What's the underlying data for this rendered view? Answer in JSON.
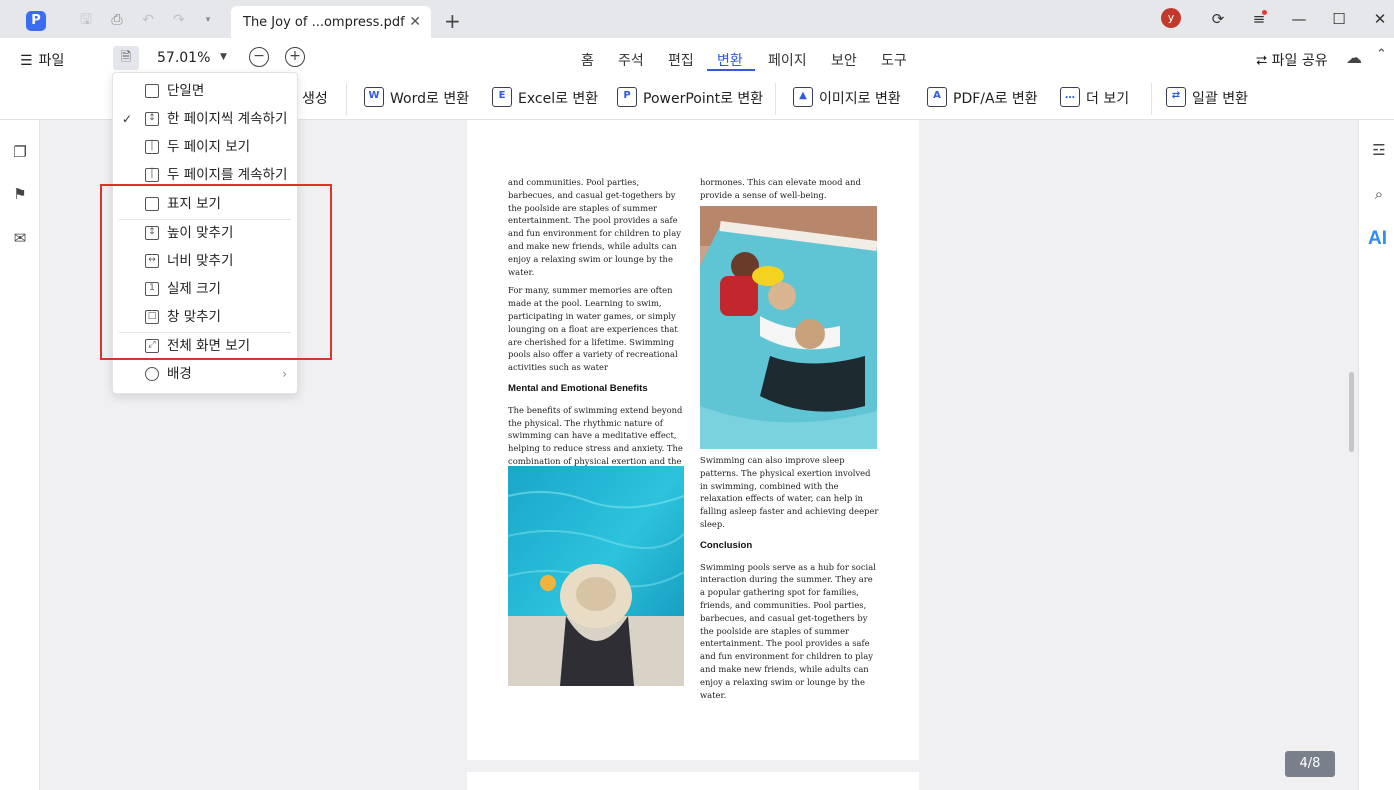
{
  "titlebar": {
    "tab_title": "The Joy of ...ompress.pdf",
    "avatar_letter": "y"
  },
  "menubar": {
    "file_label": "파일",
    "zoom_value": "57.01%",
    "tabs": [
      "홈",
      "주석",
      "편집",
      "변환",
      "페이지",
      "보안",
      "도구"
    ],
    "active_tab": "변환",
    "share_label": "파일 공유"
  },
  "toolbar": {
    "create_label": "생성",
    "word_label": "Word로 변환",
    "excel_label": "Excel로 변환",
    "ppt_label": "PowerPoint로 변환",
    "image_label": "이미지로 변환",
    "pdfa_label": "PDF/A로 변환",
    "more_label": "더 보기",
    "batch_label": "일괄 변환"
  },
  "view_menu": {
    "items": [
      {
        "label": "단일면",
        "checked": false
      },
      {
        "label": "한 페이지씩 계속하기",
        "checked": true
      },
      {
        "label": "두 페이지 보기",
        "checked": false
      },
      {
        "label": "두 페이지를 계속하기",
        "checked": false
      },
      {
        "label": "표지 보기",
        "checked": false
      },
      {
        "label": "높이 맞추기",
        "checked": false
      },
      {
        "label": "너비 맞추기",
        "checked": false
      },
      {
        "label": "실제 크기",
        "checked": false
      },
      {
        "label": "창 맞추기",
        "checked": false
      },
      {
        "label": "전체 화면 보기",
        "checked": false
      },
      {
        "label": "배경",
        "checked": false
      }
    ]
  },
  "document": {
    "left_col": {
      "p1": "and communities. Pool parties, barbecues, and casual get-togethers by the poolside are staples of summer entertainment. The pool provides a safe and fun environment for children to play and make new friends, while adults can enjoy a relaxing swim or lounge by the water.",
      "p2": "For many, summer memories are often made at the pool. Learning to swim, participating in water games, or simply lounging on a float are experiences that are cherished for a lifetime. Swimming pools also offer a variety of recreational activities such as water",
      "heading": "Mental and Emotional Benefits",
      "p3": "The benefits of swimming extend beyond the physical. The rhythmic nature of swimming can have a meditative effect, helping to reduce stress and anxiety. The combination of physical exertion and the calming properties of water can lead to the release of endorphins, often referred to as \"feel-good\""
    },
    "right_col": {
      "p1": "hormones. This can elevate mood and provide a sense of well-being.",
      "p2": "Swimming can also improve sleep patterns. The physical exertion involved in swimming, combined with the relaxation effects of water, can help in falling asleep faster and achieving deeper sleep.",
      "heading": "Conclusion",
      "p3": "Swimming pools serve as a hub for social interaction during the summer. They are a popular gathering spot for families, friends, and communities. Pool parties, barbecues, and casual get-togethers by the poolside are staples of summer entertainment. The pool provides a safe and fun environment for children to play and make new friends, while adults can enjoy a relaxing swim or lounge by the water."
    }
  },
  "page_indicator": "4/8",
  "colors": {
    "accent": "#2f5be0",
    "highlight": "#d9342b",
    "titlebar_bg": "#e6e7eb"
  }
}
